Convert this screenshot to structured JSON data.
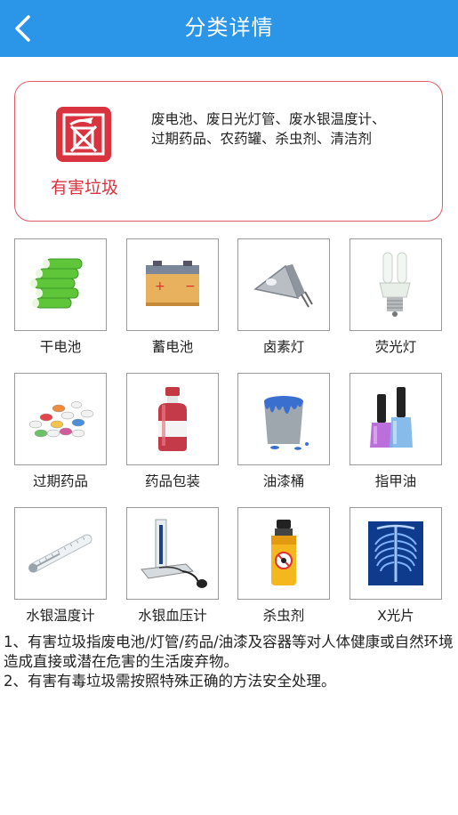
{
  "header": {
    "title": "分类详情",
    "back_icon": "chevron-left-icon",
    "color": "#2b95e8"
  },
  "category": {
    "name": "有害垃圾",
    "icon": "hazardous-waste-icon",
    "accent": "#d8333f",
    "description_lines": [
      "废电池、废日光灯管、废水银温度计、",
      "过期药品、农药罐、杀虫剂、清洁剂"
    ]
  },
  "items": [
    {
      "label": "干电池",
      "icon": "dry-battery-icon"
    },
    {
      "label": "蓄电池",
      "icon": "storage-battery-icon"
    },
    {
      "label": "卤素灯",
      "icon": "halogen-lamp-icon"
    },
    {
      "label": "荧光灯",
      "icon": "fluorescent-lamp-icon"
    },
    {
      "label": "过期药品",
      "icon": "expired-medicine-icon"
    },
    {
      "label": "药品包装",
      "icon": "medicine-bottle-icon"
    },
    {
      "label": "油漆桶",
      "icon": "paint-bucket-icon"
    },
    {
      "label": "指甲油",
      "icon": "nail-polish-icon"
    },
    {
      "label": "水银温度计",
      "icon": "mercury-thermometer-icon"
    },
    {
      "label": "水银血压计",
      "icon": "mercury-sphygmomanometer-icon"
    },
    {
      "label": "杀虫剂",
      "icon": "insecticide-spray-icon"
    },
    {
      "label": "X光片",
      "icon": "x-ray-film-icon"
    }
  ],
  "notes": [
    "1、有害垃圾指废电池/灯管/药品/油漆及容器等对人体健康或自然环境造成直接或潜在危害的生活废弃物。",
    "2、有害有毒垃圾需按照特殊正确的方法安全处理。"
  ]
}
